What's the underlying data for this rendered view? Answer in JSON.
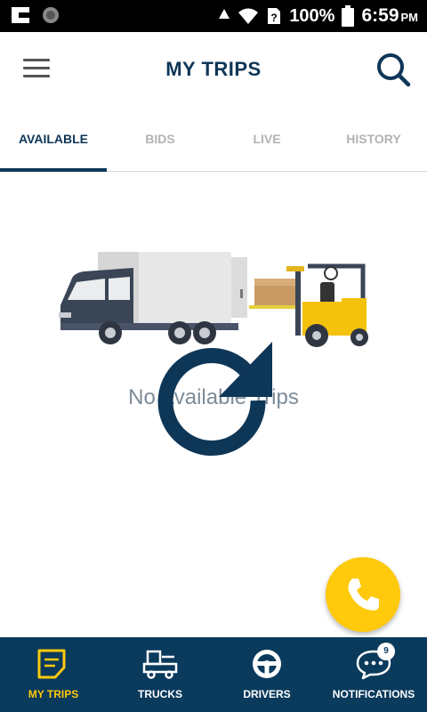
{
  "status_bar": {
    "battery": "100%",
    "time": "6:59",
    "ampm": "PM"
  },
  "header": {
    "title": "MY TRIPS"
  },
  "tabs": [
    {
      "label": "AVAILABLE",
      "active": true
    },
    {
      "label": "BIDS",
      "active": false
    },
    {
      "label": "LIVE",
      "active": false
    },
    {
      "label": "HISTORY",
      "active": false
    }
  ],
  "content": {
    "empty_message": "No Available Trips"
  },
  "bottom_nav": [
    {
      "label": "MY TRIPS",
      "icon": "trips-icon",
      "active": true
    },
    {
      "label": "TRUCKS",
      "icon": "truck-icon",
      "active": false
    },
    {
      "label": "DRIVERS",
      "icon": "steering-wheel-icon",
      "active": false
    },
    {
      "label": "NOTIFICATIONS",
      "icon": "chat-icon",
      "active": false,
      "badge": "9"
    }
  ],
  "colors": {
    "primary": "#0e3657",
    "accent": "#ffc90c",
    "nav_background": "#0a3a5c",
    "inactive_tab": "#b3b3b3"
  }
}
